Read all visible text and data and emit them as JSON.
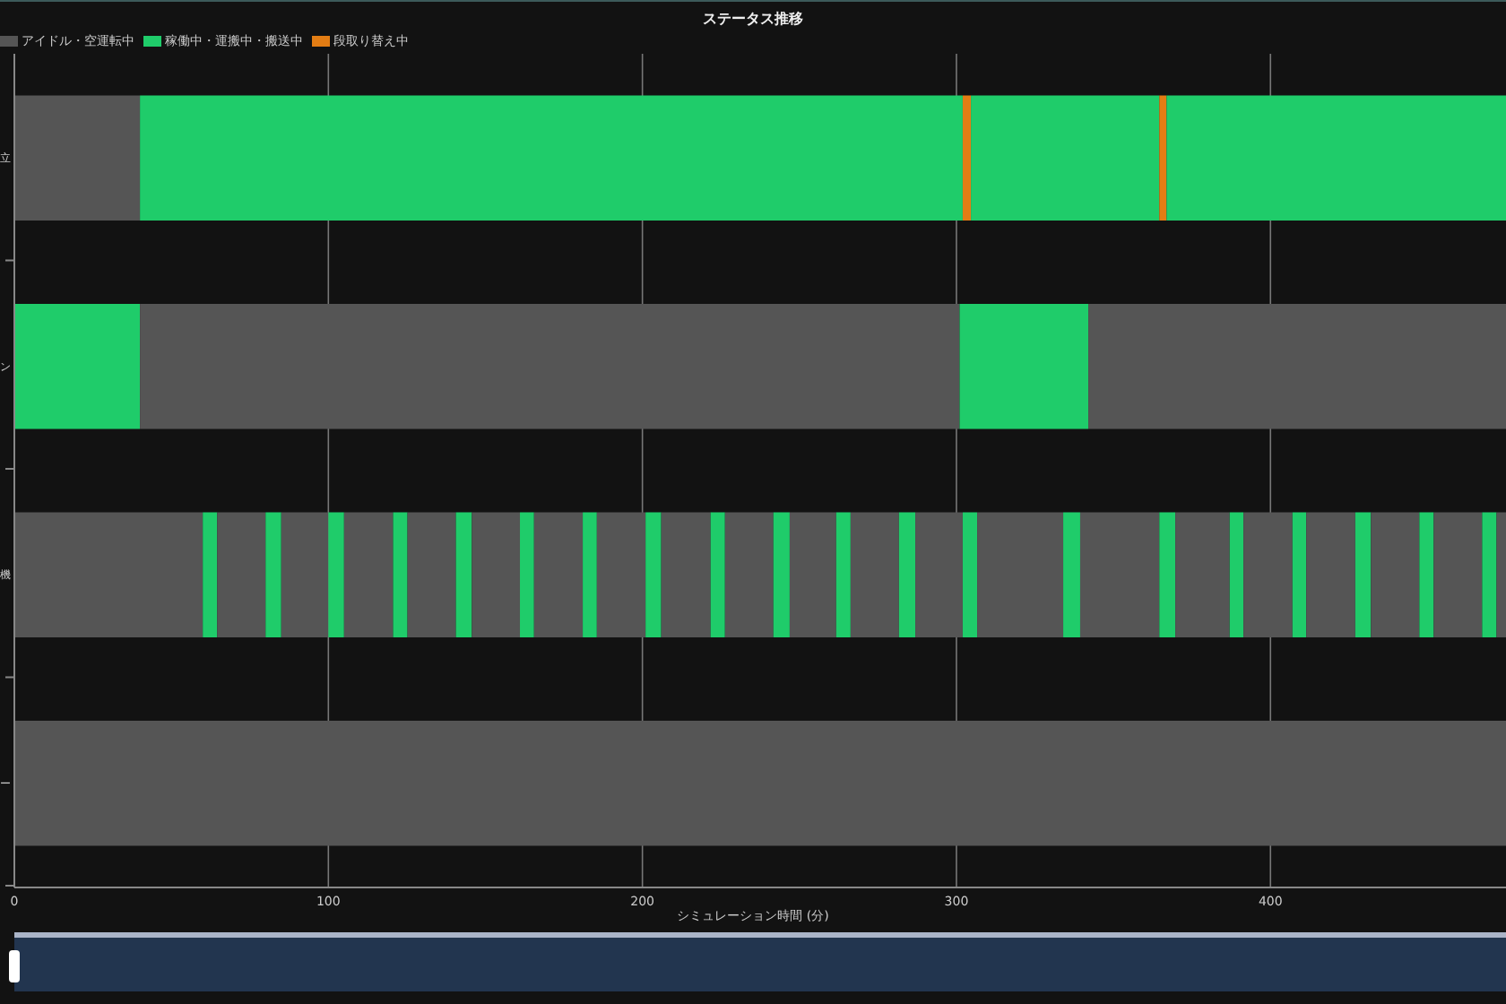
{
  "chart_data": {
    "type": "bar",
    "orientation": "horizontal",
    "stacked": true,
    "grid": true,
    "title": "ステータス推移",
    "xlabel": "シミュレーション時間 (分)",
    "xlim": [
      0,
      475
    ],
    "xticks": [
      0,
      100,
      200,
      300,
      400
    ],
    "categories": [
      "立",
      "ン",
      "機",
      "ー"
    ],
    "series": [
      {
        "name": "アイドル・空運転中",
        "color": "#555555",
        "values": [
          40,
          null,
          null,
          null
        ]
      },
      {
        "name": "稼働中・運搬中・搬送中",
        "color": "#1fcc6a",
        "values": [
          262,
          null,
          null,
          null
        ]
      },
      {
        "name": "段取り替え中",
        "color": "#e37d14",
        "values": [
          2.6,
          null,
          null,
          null
        ]
      },
      {
        "color": "#1fcc6a",
        "values": [
          60,
          null,
          null,
          null
        ]
      },
      {
        "color": "#e37d14",
        "values": [
          2.3,
          null,
          null,
          null
        ]
      },
      {
        "color": "#1fcc6a",
        "values": [
          108.1,
          null,
          null,
          null
        ]
      },
      {
        "color": "#1fcc6a",
        "values": [
          null,
          40,
          null,
          null
        ]
      },
      {
        "color": "#555555",
        "values": [
          null,
          261,
          null,
          null
        ]
      },
      {
        "color": "#1fcc6a",
        "values": [
          null,
          41,
          null,
          null
        ]
      },
      {
        "color": "#555555",
        "values": [
          null,
          133,
          null,
          null
        ]
      },
      {
        "color": "#555555",
        "values": [
          null,
          null,
          60,
          null
        ]
      },
      {
        "color": "#1fcc6a",
        "values": [
          null,
          null,
          4.6,
          null
        ]
      },
      {
        "color": "#555555",
        "values": [
          null,
          null,
          15.4,
          null
        ]
      },
      {
        "color": "#1fcc6a",
        "values": [
          null,
          null,
          5,
          null
        ]
      },
      {
        "color": "#555555",
        "values": [
          null,
          null,
          15,
          null
        ]
      },
      {
        "color": "#1fcc6a",
        "values": [
          null,
          null,
          5,
          null
        ]
      },
      {
        "color": "#555555",
        "values": [
          null,
          null,
          15.6,
          null
        ]
      },
      {
        "color": "#1fcc6a",
        "values": [
          null,
          null,
          4.6,
          null
        ]
      },
      {
        "color": "#555555",
        "values": [
          null,
          null,
          15.4,
          null
        ]
      },
      {
        "color": "#1fcc6a",
        "values": [
          null,
          null,
          5.1,
          null
        ]
      },
      {
        "color": "#555555",
        "values": [
          null,
          null,
          15.3,
          null
        ]
      },
      {
        "color": "#1fcc6a",
        "values": [
          null,
          null,
          4.5,
          null
        ]
      },
      {
        "color": "#555555",
        "values": [
          null,
          null,
          15.5,
          null
        ]
      },
      {
        "color": "#1fcc6a",
        "values": [
          null,
          null,
          4.5,
          null
        ]
      },
      {
        "color": "#555555",
        "values": [
          null,
          null,
          15.5,
          null
        ]
      },
      {
        "color": "#1fcc6a",
        "values": [
          null,
          null,
          5,
          null
        ]
      },
      {
        "color": "#555555",
        "values": [
          null,
          null,
          15.7,
          null
        ]
      },
      {
        "color": "#1fcc6a",
        "values": [
          null,
          null,
          4.6,
          null
        ]
      },
      {
        "color": "#555555",
        "values": [
          null,
          null,
          15.4,
          null
        ]
      },
      {
        "color": "#1fcc6a",
        "values": [
          null,
          null,
          5.2,
          null
        ]
      },
      {
        "color": "#555555",
        "values": [
          null,
          null,
          14.8,
          null
        ]
      },
      {
        "color": "#1fcc6a",
        "values": [
          null,
          null,
          4.6,
          null
        ]
      },
      {
        "color": "#555555",
        "values": [
          null,
          null,
          15.4,
          null
        ]
      },
      {
        "color": "#1fcc6a",
        "values": [
          null,
          null,
          5.2,
          null
        ]
      },
      {
        "color": "#555555",
        "values": [
          null,
          null,
          15.1,
          null
        ]
      },
      {
        "color": "#1fcc6a",
        "values": [
          null,
          null,
          4.6,
          null
        ]
      },
      {
        "color": "#555555",
        "values": [
          null,
          null,
          27.4,
          null
        ]
      },
      {
        "color": "#1fcc6a",
        "values": [
          null,
          null,
          5.4,
          null
        ]
      },
      {
        "color": "#555555",
        "values": [
          null,
          null,
          25.2,
          null
        ]
      },
      {
        "color": "#1fcc6a",
        "values": [
          null,
          null,
          5.1,
          null
        ]
      },
      {
        "color": "#555555",
        "values": [
          null,
          null,
          17.3,
          null
        ]
      },
      {
        "color": "#1fcc6a",
        "values": [
          null,
          null,
          4.4,
          null
        ]
      },
      {
        "color": "#555555",
        "values": [
          null,
          null,
          15.6,
          null
        ]
      },
      {
        "color": "#1fcc6a",
        "values": [
          null,
          null,
          4.4,
          null
        ]
      },
      {
        "color": "#555555",
        "values": [
          null,
          null,
          15.6,
          null
        ]
      },
      {
        "color": "#1fcc6a",
        "values": [
          null,
          null,
          5,
          null
        ]
      },
      {
        "color": "#555555",
        "values": [
          null,
          null,
          15.4,
          null
        ]
      },
      {
        "color": "#1fcc6a",
        "values": [
          null,
          null,
          4.6,
          null
        ]
      },
      {
        "color": "#555555",
        "values": [
          null,
          null,
          15.4,
          null
        ]
      },
      {
        "color": "#1fcc6a",
        "values": [
          null,
          null,
          4.6,
          null
        ]
      },
      {
        "color": "#555555",
        "values": [
          null,
          null,
          3,
          null
        ]
      },
      {
        "color": "#555555",
        "values": [
          null,
          null,
          null,
          475
        ]
      }
    ]
  },
  "range_slider": {
    "level": 0
  }
}
